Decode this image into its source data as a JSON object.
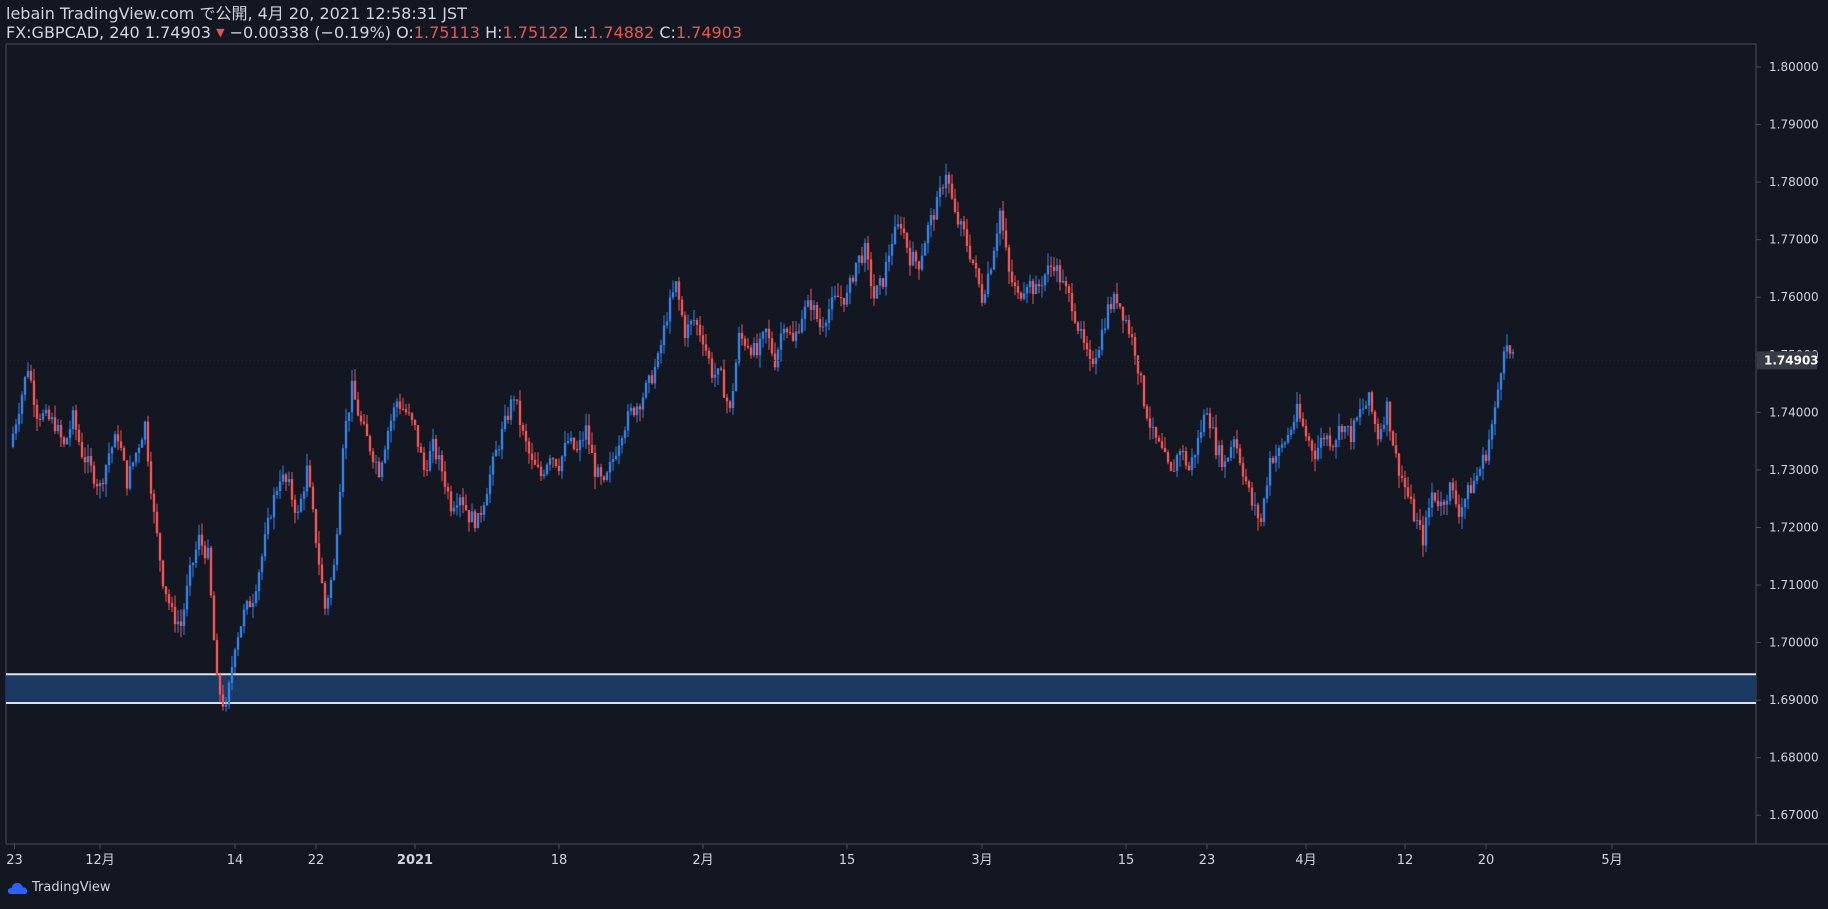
{
  "header": {
    "line1": "lebain TradingView.com で公開, 4月 20, 2021 12:58:31 JST",
    "symbol_interval_price": "FX:GBPCAD, 240 1.74903",
    "change_arrow": "▼",
    "change": "−0.00338 (−0.19%)",
    "o_label": "O:",
    "o_value": "1.75113",
    "h_label": "H:",
    "h_value": "1.75122",
    "l_label": "L:",
    "l_value": "1.74882",
    "c_label": "C:",
    "c_value": "1.74903"
  },
  "footer": {
    "brand": "TradingView"
  },
  "colors": {
    "background": "#131722",
    "up": "#2f80e4",
    "down": "#ef5350",
    "zone_fill": "#1b3a63",
    "zone_border": "#d8e4f2",
    "axis_text": "#d1d4dc",
    "price_tag_bg": "#363a45"
  },
  "chart_data": {
    "type": "candlestick",
    "symbol": "FX:GBPCAD",
    "interval": "240",
    "ylim": [
      1.665,
      1.804
    ],
    "y_ticks": [
      "1.80000",
      "1.79000",
      "1.78000",
      "1.77000",
      "1.76000",
      "1.75000",
      "1.74000",
      "1.73000",
      "1.72000",
      "1.71000",
      "1.70000",
      "1.69000",
      "1.68000",
      "1.67000"
    ],
    "x_ticks": [
      {
        "label": "23",
        "t": 0.5
      },
      {
        "label": "12月",
        "t": 10
      },
      {
        "label": "14",
        "t": 25
      },
      {
        "label": "22",
        "t": 34
      },
      {
        "label": "2021",
        "t": 45,
        "bold": true
      },
      {
        "label": "18",
        "t": 61
      },
      {
        "label": "2月",
        "t": 77
      },
      {
        "label": "15",
        "t": 93
      },
      {
        "label": "3月",
        "t": 108
      },
      {
        "label": "15",
        "t": 124
      },
      {
        "label": "23",
        "t": 133
      },
      {
        "label": "4月",
        "t": 144
      },
      {
        "label": "12",
        "t": 155
      },
      {
        "label": "20",
        "t": 164
      },
      {
        "label": "5月",
        "t": 178
      }
    ],
    "last_price": "1.74903",
    "last_price_value": 1.74903,
    "zone": {
      "low": 1.6895,
      "high": 1.6945
    },
    "swing_points": [
      [
        0,
        1.734
      ],
      [
        1,
        1.741
      ],
      [
        2,
        1.748
      ],
      [
        3,
        1.74
      ],
      [
        5,
        1.738
      ],
      [
        6,
        1.734
      ],
      [
        7,
        1.739
      ],
      [
        8,
        1.733
      ],
      [
        9,
        1.73
      ],
      [
        10,
        1.727
      ],
      [
        11,
        1.733
      ],
      [
        12,
        1.736
      ],
      [
        13,
        1.728
      ],
      [
        14,
        1.733
      ],
      [
        15,
        1.738
      ],
      [
        16,
        1.722
      ],
      [
        17,
        1.711
      ],
      [
        18,
        1.705
      ],
      [
        19,
        1.703
      ],
      [
        20,
        1.712
      ],
      [
        21,
        1.718
      ],
      [
        22,
        1.715
      ],
      [
        23,
        1.693
      ],
      [
        24,
        1.688
      ],
      [
        25,
        1.7
      ],
      [
        26,
        1.705
      ],
      [
        27,
        1.708
      ],
      [
        28,
        1.715
      ],
      [
        29,
        1.723
      ],
      [
        30,
        1.729
      ],
      [
        31,
        1.727
      ],
      [
        32,
        1.722
      ],
      [
        33,
        1.73
      ],
      [
        34,
        1.718
      ],
      [
        35,
        1.706
      ],
      [
        36,
        1.713
      ],
      [
        37,
        1.735
      ],
      [
        38,
        1.744
      ],
      [
        39,
        1.738
      ],
      [
        40,
        1.734
      ],
      [
        41,
        1.73
      ],
      [
        42,
        1.737
      ],
      [
        43,
        1.742
      ],
      [
        44,
        1.74
      ],
      [
        45,
        1.737
      ],
      [
        46,
        1.73
      ],
      [
        47,
        1.734
      ],
      [
        48,
        1.73
      ],
      [
        49,
        1.724
      ],
      [
        50,
        1.726
      ],
      [
        51,
        1.722
      ],
      [
        52,
        1.721
      ],
      [
        53,
        1.727
      ],
      [
        54,
        1.733
      ],
      [
        55,
        1.738
      ],
      [
        56,
        1.743
      ],
      [
        57,
        1.736
      ],
      [
        58,
        1.731
      ],
      [
        59,
        1.729
      ],
      [
        60,
        1.733
      ],
      [
        61,
        1.731
      ],
      [
        62,
        1.735
      ],
      [
        63,
        1.733
      ],
      [
        64,
        1.737
      ],
      [
        65,
        1.73
      ],
      [
        66,
        1.727
      ],
      [
        67,
        1.732
      ],
      [
        68,
        1.737
      ],
      [
        69,
        1.74
      ],
      [
        70,
        1.742
      ],
      [
        71,
        1.745
      ],
      [
        72,
        1.749
      ],
      [
        73,
        1.757
      ],
      [
        74,
        1.762
      ],
      [
        75,
        1.754
      ],
      [
        76,
        1.756
      ],
      [
        77,
        1.753
      ],
      [
        78,
        1.747
      ],
      [
        79,
        1.746
      ],
      [
        80,
        1.74
      ],
      [
        81,
        1.753
      ],
      [
        82,
        1.752
      ],
      [
        83,
        1.75
      ],
      [
        84,
        1.754
      ],
      [
        85,
        1.749
      ],
      [
        86,
        1.756
      ],
      [
        87,
        1.752
      ],
      [
        88,
        1.757
      ],
      [
        89,
        1.759
      ],
      [
        90,
        1.755
      ],
      [
        91,
        1.758
      ],
      [
        92,
        1.76
      ],
      [
        93,
        1.76
      ],
      [
        94,
        1.766
      ],
      [
        95,
        1.768
      ],
      [
        96,
        1.76
      ],
      [
        97,
        1.763
      ],
      [
        98,
        1.77
      ],
      [
        99,
        1.773
      ],
      [
        100,
        1.767
      ],
      [
        101,
        1.766
      ],
      [
        102,
        1.772
      ],
      [
        103,
        1.776
      ],
      [
        104,
        1.782
      ],
      [
        105,
        1.774
      ],
      [
        106,
        1.771
      ],
      [
        107,
        1.766
      ],
      [
        108,
        1.76
      ],
      [
        109,
        1.766
      ],
      [
        110,
        1.775
      ],
      [
        111,
        1.764
      ],
      [
        112,
        1.76
      ],
      [
        113,
        1.763
      ],
      [
        114,
        1.761
      ],
      [
        115,
        1.764
      ],
      [
        116,
        1.766
      ],
      [
        117,
        1.762
      ],
      [
        118,
        1.759
      ],
      [
        119,
        1.753
      ],
      [
        120,
        1.748
      ],
      [
        121,
        1.752
      ],
      [
        122,
        1.758
      ],
      [
        123,
        1.76
      ],
      [
        124,
        1.756
      ],
      [
        125,
        1.751
      ],
      [
        126,
        1.742
      ],
      [
        127,
        1.736
      ],
      [
        128,
        1.733
      ],
      [
        129,
        1.729
      ],
      [
        130,
        1.734
      ],
      [
        131,
        1.73
      ],
      [
        132,
        1.735
      ],
      [
        133,
        1.741
      ],
      [
        134,
        1.734
      ],
      [
        135,
        1.731
      ],
      [
        136,
        1.736
      ],
      [
        137,
        1.73
      ],
      [
        138,
        1.724
      ],
      [
        139,
        1.721
      ],
      [
        140,
        1.732
      ],
      [
        141,
        1.733
      ],
      [
        142,
        1.736
      ],
      [
        143,
        1.74
      ],
      [
        144,
        1.736
      ],
      [
        145,
        1.733
      ],
      [
        146,
        1.736
      ],
      [
        147,
        1.735
      ],
      [
        148,
        1.738
      ],
      [
        149,
        1.736
      ],
      [
        150,
        1.74
      ],
      [
        151,
        1.742
      ],
      [
        152,
        1.736
      ],
      [
        153,
        1.741
      ],
      [
        154,
        1.732
      ],
      [
        155,
        1.727
      ],
      [
        156,
        1.722
      ],
      [
        157,
        1.718
      ],
      [
        158,
        1.726
      ],
      [
        159,
        1.724
      ],
      [
        160,
        1.727
      ],
      [
        161,
        1.723
      ],
      [
        162,
        1.726
      ],
      [
        163,
        1.729
      ],
      [
        164,
        1.733
      ],
      [
        165,
        1.74
      ],
      [
        166,
        1.752
      ],
      [
        167,
        1.749
      ]
    ]
  }
}
